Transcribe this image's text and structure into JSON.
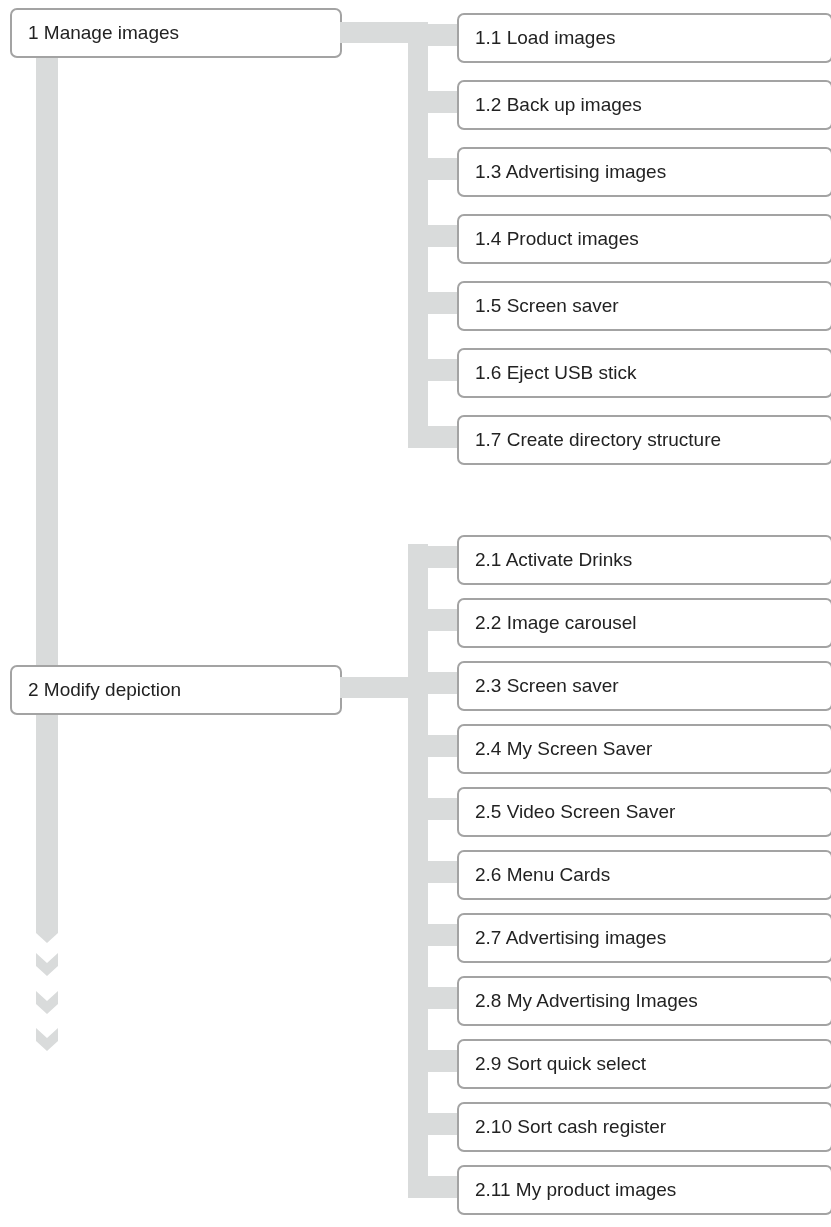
{
  "tree": [
    {
      "label": "1 Manage images",
      "children": [
        {
          "label": "1.1 Load images"
        },
        {
          "label": "1.2 Back up images"
        },
        {
          "label": "1.3 Advertising images"
        },
        {
          "label": "1.4 Product images"
        },
        {
          "label": "1.5 Screen saver"
        },
        {
          "label": "1.6 Eject USB stick"
        },
        {
          "label": "1.7 Create directory structure"
        }
      ]
    },
    {
      "label": "2 Modify depiction",
      "children": [
        {
          "label": "2.1 Activate Drinks"
        },
        {
          "label": "2.2 Image carousel"
        },
        {
          "label": "2.3 Screen saver"
        },
        {
          "label": "2.4 My Screen Saver"
        },
        {
          "label": "2.5 Video Screen Saver"
        },
        {
          "label": "2.6 Menu Cards"
        },
        {
          "label": "2.7 Advertising images"
        },
        {
          "label": "2.8 My Advertising Images"
        },
        {
          "label": "2.9 Sort quick select"
        },
        {
          "label": "2.10 Sort cash register"
        },
        {
          "label": "2.11 My product images"
        }
      ]
    }
  ]
}
